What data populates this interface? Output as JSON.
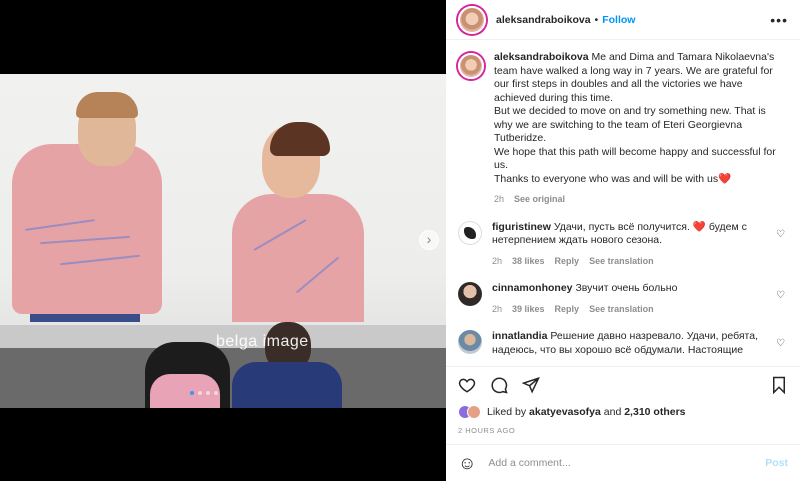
{
  "header": {
    "username": "aleksandraboikova",
    "separator": "•",
    "follow_label": "Follow",
    "more_icon": "more-horizontal-icon"
  },
  "media": {
    "watermark": "belga image",
    "next_icon": "chevron-right-icon",
    "slides_total": 4,
    "active_slide": 1
  },
  "caption": {
    "username": "aleksandraboikova",
    "lines": [
      "Me and Dima and Tamara Nikolaevna's team have walked a long way in 7 years. We are grateful for our first steps in doubles and all the victories we have achieved during this time.",
      "But we decided to move on and try something new. That is why we are switching to the team of Eteri Georgievna Tutberidze.",
      "We hope that this path will become happy and successful for us.",
      "Thanks to everyone who was and will be with us"
    ],
    "heart_emoji": "❤️",
    "time": "2h",
    "see_original": "See original"
  },
  "comments": [
    {
      "username": "figuristinew",
      "text_before": "Удачи, пусть всё получится.",
      "emoji": "❤️",
      "text_after": "будем с нетерпением ждать нового сезона.",
      "time": "2h",
      "likes": "38 likes",
      "reply": "Reply",
      "translation": "See translation"
    },
    {
      "username": "cinnamonhoney",
      "text": "Звучит очень больно",
      "time": "2h",
      "likes": "39 likes",
      "reply": "Reply",
      "translation": "See translation"
    },
    {
      "username": "innatlandia",
      "text": "Решение давно назревало. Удачи, ребята, надеюсь, что вы хорошо всё обдумали. Настоящие"
    }
  ],
  "likes": {
    "prefix": "Liked by",
    "user": "akatyevasofya",
    "and": "and",
    "count": "2,310 others"
  },
  "timestamp": "2 HOURS AGO",
  "add_comment": {
    "placeholder": "Add a comment...",
    "post_label": "Post"
  },
  "colors": {
    "accent": "#0095f6",
    "post_disabled": "#b2dffc",
    "heart_red": "#ed4956"
  }
}
